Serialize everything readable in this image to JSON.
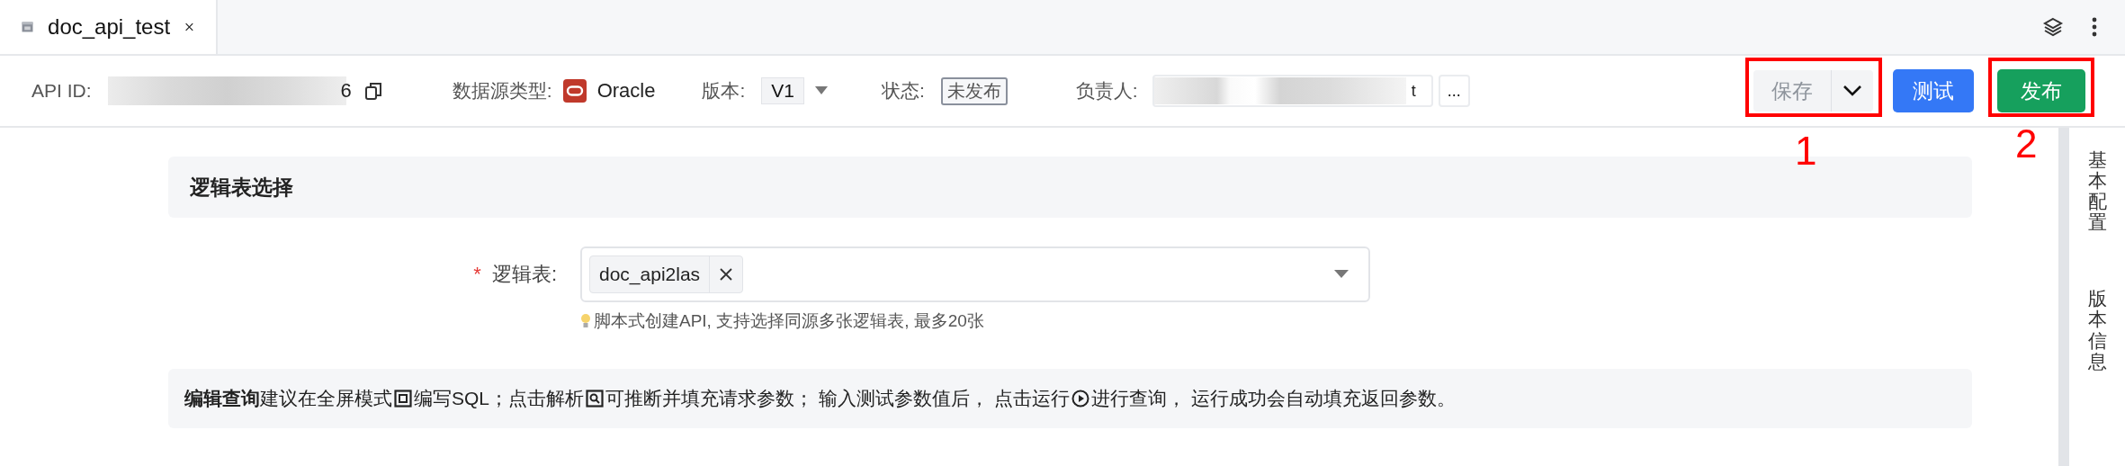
{
  "tabs": [
    {
      "label": "doc_api_test",
      "selected": true
    }
  ],
  "toolbar": {
    "api_id_label": "API ID:",
    "api_id_value_tail": "6",
    "source_label": "数据源类型:",
    "source_value": "Oracle",
    "version_label": "版本:",
    "version_value": "V1",
    "status_label": "状态:",
    "status_value": "未发布",
    "owner_label": "负责人:",
    "owner_value_tail": "t",
    "owner_more": "...",
    "buttons": [
      {
        "kind": "split",
        "label": "保存",
        "disabled": true
      },
      {
        "kind": "primary",
        "label": "测试",
        "disabled": false
      },
      {
        "kind": "success",
        "label": "发布",
        "disabled": false
      }
    ]
  },
  "annotations": [
    {
      "label": "1"
    },
    {
      "label": "2"
    }
  ],
  "section": {
    "title": "逻辑表选择",
    "field": {
      "label": "逻辑表:",
      "required_mark": "*",
      "tags": [
        "doc_api2las"
      ]
    },
    "hint": "脚本式创建API, 支持选择同源多张逻辑表, 最多20张"
  },
  "query_hint": [
    "**编辑查询**建议在全屏模式",
    "编写SQL；点击解析",
    "可推断并填充请求参数； 输入测试参数值后， 点击运行",
    "进行查询， 运行成功会自动填充返回参数。"
  ],
  "side_tabs": [
    {
      "label": "基本配置",
      "selected": false
    },
    {
      "label": "版本信息",
      "selected": false
    }
  ]
}
